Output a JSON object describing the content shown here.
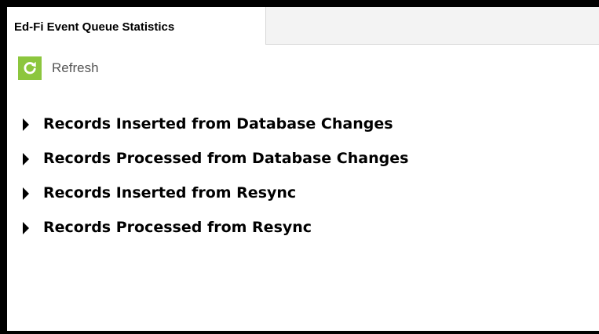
{
  "tab": {
    "label": "Ed-Fi Event Queue Statistics"
  },
  "toolbar": {
    "refresh_label": "Refresh",
    "refresh_icon": "refresh-icon",
    "accent_color": "#8cc63e"
  },
  "sections": [
    {
      "title": "Records Inserted from Database Changes",
      "expanded": false
    },
    {
      "title": "Records Processed from Database Changes",
      "expanded": false
    },
    {
      "title": "Records Inserted from Resync",
      "expanded": false
    },
    {
      "title": "Records Processed from Resync",
      "expanded": false
    }
  ]
}
